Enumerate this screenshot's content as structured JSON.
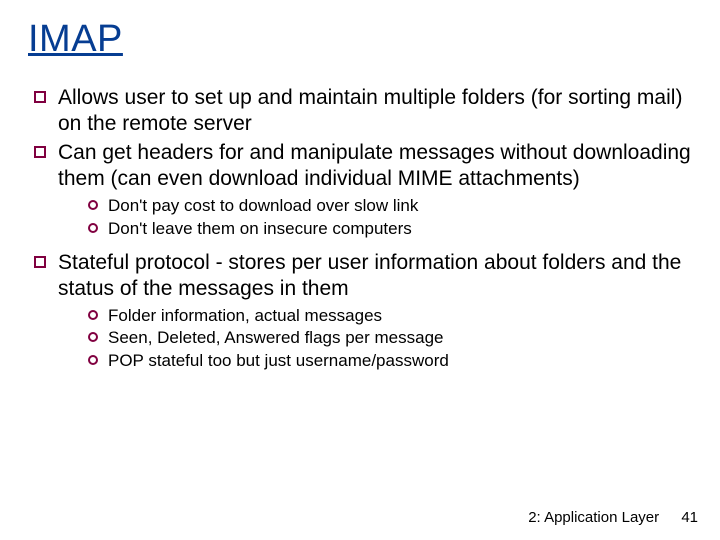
{
  "title": "IMAP",
  "bullets": [
    {
      "text": "Allows user to set up and maintain multiple folders (for sorting mail) on the remote server",
      "sub": []
    },
    {
      "text": "Can get headers for and manipulate messages without downloading them (can even download individual MIME attachments)",
      "sub": [
        "Don't pay cost to download over slow link",
        "Don't leave them on insecure computers"
      ]
    },
    {
      "text": "Stateful protocol  - stores per user information about folders and the status of the messages in them",
      "sub": [
        "Folder information, actual messages",
        "Seen, Deleted, Answered flags per message",
        "POP stateful too but just username/password"
      ]
    }
  ],
  "footer": {
    "section": "2: Application Layer",
    "page": "41"
  }
}
